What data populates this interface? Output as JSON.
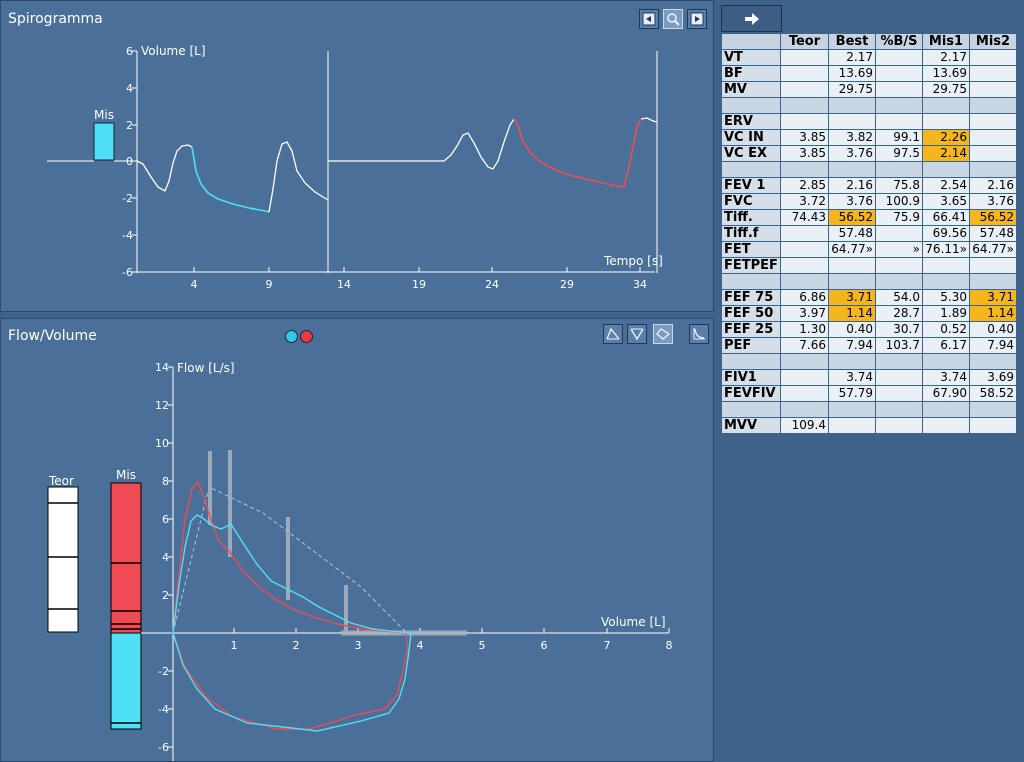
{
  "spirogram": {
    "title": "Spirogramma",
    "y_label": "Volume [L]",
    "x_label": "Tempo [s]",
    "mis_label": "Mis",
    "y_ticks": [
      "6",
      "4",
      "2",
      "0",
      "-2",
      "-4",
      "-6"
    ],
    "x_ticks_left": [
      "4",
      "9"
    ],
    "x_ticks_right": [
      "14",
      "19",
      "24",
      "29",
      "34"
    ],
    "buttons": [
      "prev-icon",
      "zoom-icon",
      "next-icon"
    ]
  },
  "flow_volume": {
    "title": "Flow/Volume",
    "y_label": "Flow [L/s]",
    "x_label": "Volume [L]",
    "teor_label": "Teor",
    "mis_label": "Mis",
    "y_ticks": [
      "14",
      "12",
      "10",
      "8",
      "6",
      "4",
      "2",
      "-2",
      "-4",
      "-6"
    ],
    "x_ticks": [
      "1",
      "2",
      "3",
      "4",
      "5",
      "6",
      "7",
      "8"
    ],
    "legend_colors": [
      "#33c9e6",
      "#e8393f"
    ],
    "buttons": [
      "expiratory-icon",
      "inspiratory-icon",
      "loop-icon",
      "volume-time-icon"
    ]
  },
  "colors": {
    "panel": "#4a6f98",
    "cyan": "#4fe0f5",
    "red": "#f04a54",
    "highlight": "#f4b61c"
  },
  "table": {
    "arrow_icon": "arrow-right-icon",
    "headers": [
      "",
      "Teor",
      "Best",
      "%B/S",
      "Mis1",
      "Mis2"
    ],
    "rows": [
      {
        "label": "VT",
        "cells": [
          "",
          "2.17",
          "",
          "2.17",
          ""
        ]
      },
      {
        "label": "BF",
        "cells": [
          "",
          "13.69",
          "",
          "13.69",
          ""
        ]
      },
      {
        "label": "MV",
        "cells": [
          "",
          "29.75",
          "",
          "29.75",
          ""
        ]
      },
      {
        "label": "",
        "cells": [
          "",
          "",
          "",
          "",
          ""
        ]
      },
      {
        "label": "ERV",
        "cells": [
          "",
          "",
          "",
          "",
          ""
        ]
      },
      {
        "label": "VC IN",
        "cells": [
          "3.85",
          "3.82",
          "99.1",
          "2.26",
          ""
        ],
        "hl": [
          3
        ]
      },
      {
        "label": "VC EX",
        "cells": [
          "3.85",
          "3.76",
          "97.5",
          "2.14",
          ""
        ],
        "hl": [
          3
        ]
      },
      {
        "label": "",
        "cells": [
          "",
          "",
          "",
          "",
          ""
        ]
      },
      {
        "label": "FEV 1",
        "cells": [
          "2.85",
          "2.16",
          "75.8",
          "2.54",
          "2.16"
        ]
      },
      {
        "label": "FVC",
        "cells": [
          "3.72",
          "3.76",
          "100.9",
          "3.65",
          "3.76"
        ]
      },
      {
        "label": "Tiff.",
        "cells": [
          "74.43",
          "56.52",
          "75.9",
          "66.41",
          "56.52"
        ],
        "hl": [
          1,
          4
        ]
      },
      {
        "label": "Tiff.f",
        "cells": [
          "",
          "57.48",
          "",
          "69.56",
          "57.48"
        ]
      },
      {
        "label": "FET",
        "cells": [
          "",
          "64.77»",
          "»",
          "76.11»",
          "64.77»"
        ]
      },
      {
        "label": "FETPEF",
        "cells": [
          "",
          "",
          "",
          "",
          ""
        ]
      },
      {
        "label": "",
        "cells": [
          "",
          "",
          "",
          "",
          ""
        ]
      },
      {
        "label": "FEF 75",
        "cells": [
          "6.86",
          "3.71",
          "54.0",
          "5.30",
          "3.71"
        ],
        "hl": [
          1,
          4
        ]
      },
      {
        "label": "FEF 50",
        "cells": [
          "3.97",
          "1.14",
          "28.7",
          "1.89",
          "1.14"
        ],
        "hl": [
          1,
          4
        ]
      },
      {
        "label": "FEF 25",
        "cells": [
          "1.30",
          "0.40",
          "30.7",
          "0.52",
          "0.40"
        ]
      },
      {
        "label": "PEF",
        "cells": [
          "7.66",
          "7.94",
          "103.7",
          "6.17",
          "7.94"
        ]
      },
      {
        "label": "",
        "cells": [
          "",
          "",
          "",
          "",
          ""
        ]
      },
      {
        "label": "FIV1",
        "cells": [
          "",
          "3.74",
          "",
          "3.74",
          "3.69"
        ]
      },
      {
        "label": "FEVFIV",
        "cells": [
          "",
          "57.79",
          "",
          "67.90",
          "58.52"
        ]
      },
      {
        "label": "",
        "cells": [
          "",
          "",
          "",
          "",
          ""
        ]
      },
      {
        "label": "MVV",
        "cells": [
          "109.4",
          "",
          "",
          "",
          ""
        ]
      }
    ]
  }
}
